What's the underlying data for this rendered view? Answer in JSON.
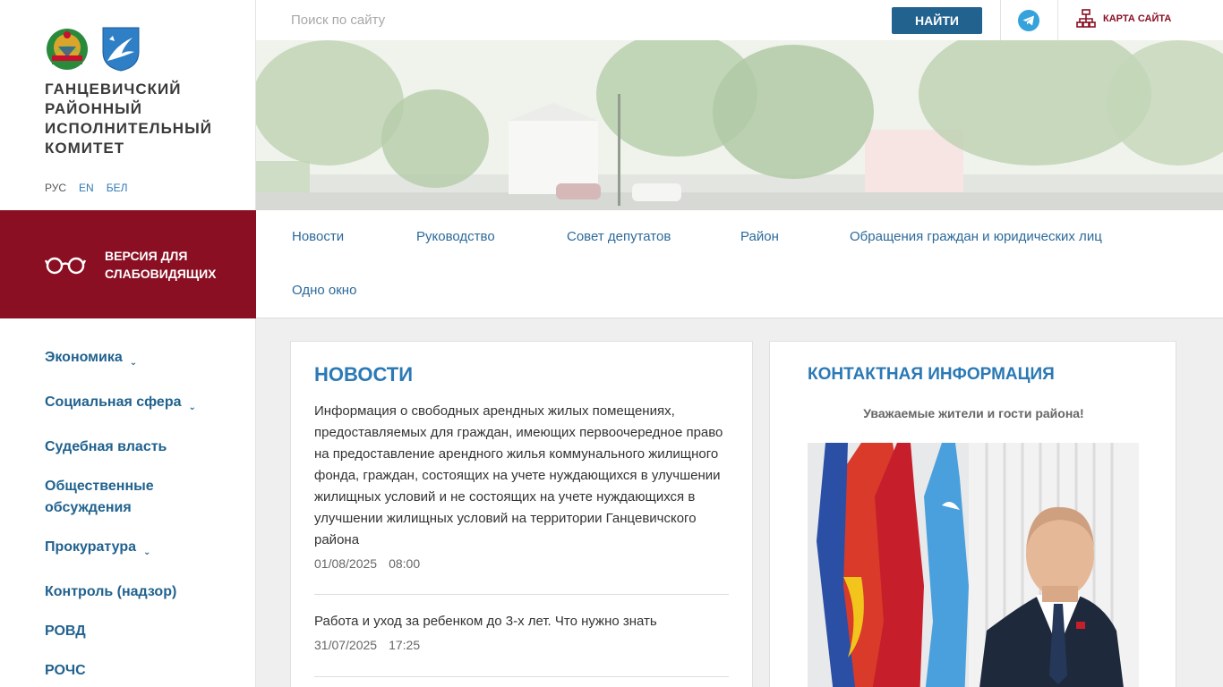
{
  "sidebar": {
    "org_title": "ГАНЦЕВИЧСКИЙ РАЙОННЫЙ ИСПОЛНИТЕЛЬНЫЙ КОМИТЕТ",
    "langs": [
      "РУС",
      "EN",
      "БЕЛ"
    ],
    "low_vision_label": "ВЕРСИЯ ДЛЯ СЛАБОВИДЯЩИХ",
    "menu": [
      {
        "label": "Экономика",
        "has_submenu": true
      },
      {
        "label": "Социальная сфера",
        "has_submenu": true
      },
      {
        "label": "Судебная власть",
        "has_submenu": false
      },
      {
        "label": "Общественные обсуждения",
        "has_submenu": false
      },
      {
        "label": "Прокуратура",
        "has_submenu": true
      },
      {
        "label": "Контроль (надзор)",
        "has_submenu": false
      },
      {
        "label": "РОВД",
        "has_submenu": false
      },
      {
        "label": "РОЧС",
        "has_submenu": false
      }
    ]
  },
  "topbar": {
    "search_placeholder": "Поиск по сайту",
    "find_label": "НАЙТИ",
    "sitemap_label": "КАРТА САЙТА"
  },
  "main_nav": {
    "items": [
      "Новости",
      "Руководство",
      "Совет депутатов",
      "Район",
      "Обращения граждан и юридических лиц",
      "Одно окно"
    ]
  },
  "news": {
    "title": "НОВОСТИ",
    "items": [
      {
        "text": "Информация о свободных арендных жилых помещениях, предоставляемых для граждан, имеющих первоочередное право на предоставление арендного жилья коммунального жилищного фонда, граждан, состоящих на учете нуждающихся в улучшении жилищных условий и не состоящих на учете нуждающихся в улучшении жилищных условий на территории Ганцевичского района",
        "date": "01/08/2025",
        "time": "08:00"
      },
      {
        "text": "Работа и уход за ребенком до 3-х лет. Что нужно знать",
        "date": "31/07/2025",
        "time": "17:25"
      }
    ]
  },
  "contact": {
    "title": "КОНТАКТНАЯ ИНФОРМАЦИЯ",
    "greeting": "Уважаемые жители и гости района!"
  },
  "colors": {
    "accent": "#21628f",
    "brand_dark_red": "#8a0f23",
    "link": "#2c6a9a",
    "heading": "#2b79b5",
    "telegram": "#35a2dc"
  },
  "icons": [
    "belarus-emblem-icon",
    "district-coat-of-arms-icon",
    "glasses-icon",
    "telegram-icon",
    "sitemap-icon",
    "chevron-down-icon"
  ]
}
